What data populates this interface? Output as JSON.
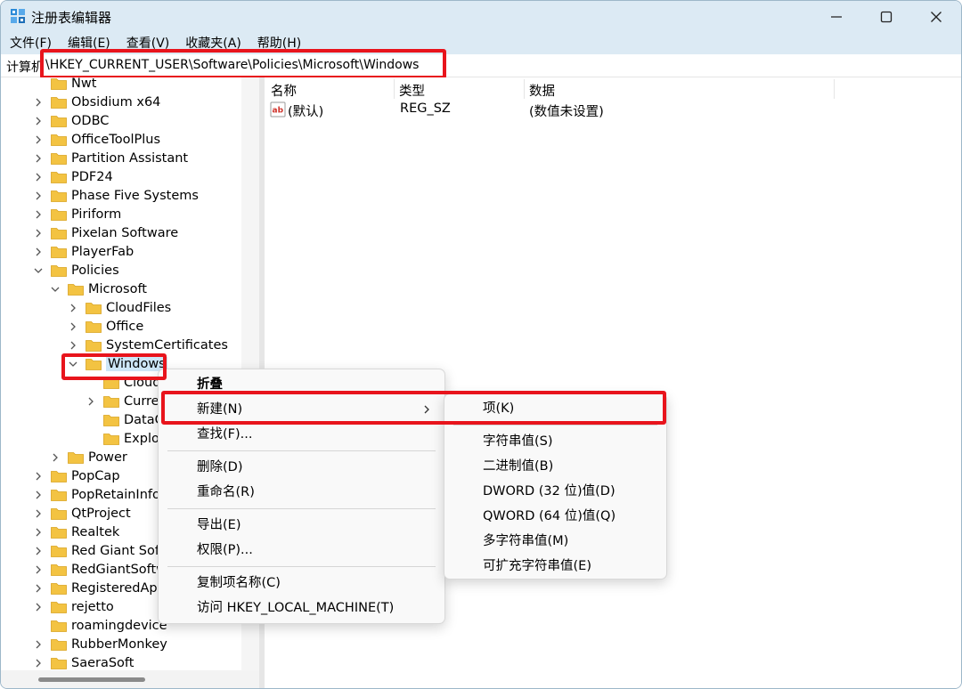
{
  "window": {
    "title": "注册表编辑器"
  },
  "menubar": [
    "文件(F)",
    "编辑(E)",
    "查看(V)",
    "收藏夹(A)",
    "帮助(H)"
  ],
  "address": {
    "prefix": "计算机",
    "path": "\\HKEY_CURRENT_USER\\Software\\Policies\\Microsoft\\Windows"
  },
  "tree": [
    {
      "label": "Nwt",
      "level": 0,
      "state": "partial"
    },
    {
      "label": "Obsidium x64",
      "level": 0,
      "state": "collapsed"
    },
    {
      "label": "ODBC",
      "level": 0,
      "state": "collapsed"
    },
    {
      "label": "OfficeToolPlus",
      "level": 0,
      "state": "collapsed"
    },
    {
      "label": "Partition Assistant",
      "level": 0,
      "state": "collapsed"
    },
    {
      "label": "PDF24",
      "level": 0,
      "state": "collapsed"
    },
    {
      "label": "Phase Five Systems",
      "level": 0,
      "state": "collapsed"
    },
    {
      "label": "Piriform",
      "level": 0,
      "state": "collapsed"
    },
    {
      "label": "Pixelan Software",
      "level": 0,
      "state": "collapsed"
    },
    {
      "label": "PlayerFab",
      "level": 0,
      "state": "collapsed"
    },
    {
      "label": "Policies",
      "level": 0,
      "state": "expanded"
    },
    {
      "label": "Microsoft",
      "level": 1,
      "state": "expanded"
    },
    {
      "label": "CloudFiles",
      "level": 2,
      "state": "collapsed"
    },
    {
      "label": "Office",
      "level": 2,
      "state": "collapsed"
    },
    {
      "label": "SystemCertificates",
      "level": 2,
      "state": "collapsed"
    },
    {
      "label": "Windows",
      "level": 2,
      "state": "expanded",
      "selected": true
    },
    {
      "label": "CloudC",
      "level": 3,
      "state": "none"
    },
    {
      "label": "Currer",
      "level": 3,
      "state": "collapsed"
    },
    {
      "label": "DataC",
      "level": 3,
      "state": "none"
    },
    {
      "label": "Explor",
      "level": 3,
      "state": "none"
    },
    {
      "label": "Power",
      "level": 1,
      "state": "collapsed"
    },
    {
      "label": "PopCap",
      "level": 0,
      "state": "collapsed"
    },
    {
      "label": "PopRetainInfo",
      "level": 0,
      "state": "collapsed"
    },
    {
      "label": "QtProject",
      "level": 0,
      "state": "collapsed"
    },
    {
      "label": "Realtek",
      "level": 0,
      "state": "collapsed"
    },
    {
      "label": "Red Giant Softw",
      "level": 0,
      "state": "collapsed"
    },
    {
      "label": "RedGiantSoftw",
      "level": 0,
      "state": "collapsed"
    },
    {
      "label": "RegisteredApp",
      "level": 0,
      "state": "collapsed"
    },
    {
      "label": "rejetto",
      "level": 0,
      "state": "collapsed"
    },
    {
      "label": "roamingdevice",
      "level": 0,
      "state": "none"
    },
    {
      "label": "RubberMonkey",
      "level": 0,
      "state": "collapsed"
    },
    {
      "label": "SaeraSoft",
      "level": 0,
      "state": "collapsed"
    }
  ],
  "list": {
    "columns": [
      "名称",
      "类型",
      "数据"
    ],
    "rows": [
      {
        "name": "(默认)",
        "type": "REG_SZ",
        "data": "(数值未设置)"
      }
    ]
  },
  "context_menu": {
    "items": [
      {
        "label": "折叠",
        "bold": true
      },
      {
        "label": "新建(N)",
        "submenu": true
      },
      {
        "label": "查找(F)..."
      },
      {
        "sep": true
      },
      {
        "label": "删除(D)"
      },
      {
        "label": "重命名(R)"
      },
      {
        "sep": true
      },
      {
        "label": "导出(E)"
      },
      {
        "label": "权限(P)..."
      },
      {
        "sep": true
      },
      {
        "label": "复制项名称(C)"
      },
      {
        "label": "访问 HKEY_LOCAL_MACHINE(T)"
      }
    ]
  },
  "submenu": {
    "items": [
      {
        "label": "项(K)"
      },
      {
        "sep": true
      },
      {
        "label": "字符串值(S)"
      },
      {
        "label": "二进制值(B)"
      },
      {
        "label": "DWORD (32 位)值(D)"
      },
      {
        "label": "QWORD (64 位)值(Q)"
      },
      {
        "label": "多字符串值(M)"
      },
      {
        "label": "可扩充字符串值(E)"
      }
    ]
  },
  "colors": {
    "titlebar": "#dceaf4",
    "highlight": "#e8141c",
    "folder": "#f3c342"
  }
}
